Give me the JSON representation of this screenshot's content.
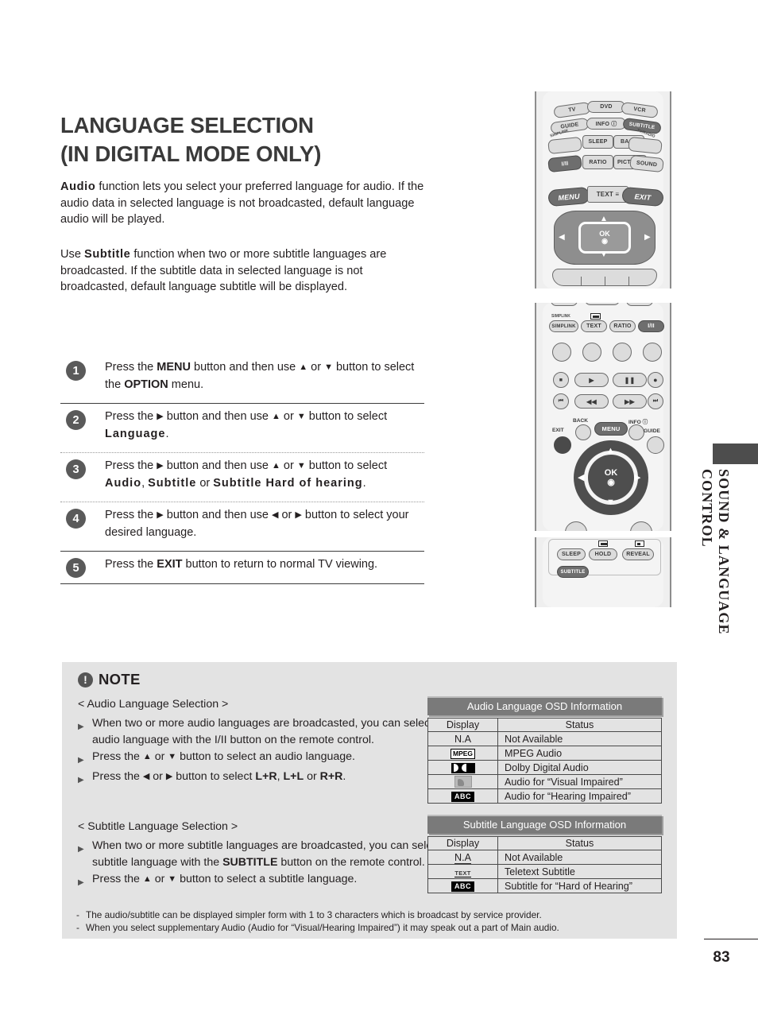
{
  "title": {
    "line1": "LANGUAGE SELECTION",
    "line2": "(IN DIGITAL MODE ONLY)"
  },
  "intro": {
    "p1_bold": "Audio",
    "p1_rest": " function lets you select your preferred language for audio. If the audio data in selected language is not broadcasted, default language audio will be played.",
    "p2_pre": "Use ",
    "p2_bold": "Subtitle",
    "p2_rest": " function when two or more subtitle languages are broadcasted. If the subtitle data in selected language is not broadcasted, default language subtitle will be displayed."
  },
  "steps": [
    {
      "num": "1",
      "html": "Press the <b>MENU</b> button and then use <span class=\"arw\">▲</span> or <span class=\"arw\">▼</span> button to select the <b>OPTION</b> menu."
    },
    {
      "num": "2",
      "html": "Press the <span class=\"arw\">▶</span> button and then use <span class=\"arw\">▲</span> or <span class=\"arw\">▼</span> button to select <span class=\"sp\">Language</span>."
    },
    {
      "num": "3",
      "html": "Press the <span class=\"arw\">▶</span> button and then use <span class=\"arw\">▲</span> or <span class=\"arw\">▼</span> button to select <span class=\"sp\">Audio</span>, <span class=\"sp\">Subtitle</span> or <span class=\"sp\">Subtitle Hard of hearing</span>."
    },
    {
      "num": "4",
      "html": "Press the <span class=\"arw\">▶</span> button and then use <span class=\"arw\">◀</span> or <span class=\"arw\">▶</span> button to select your desired language."
    },
    {
      "num": "5",
      "html": "Press the <b>EXIT</b> button to return to normal TV viewing."
    }
  ],
  "remote1": {
    "buttons": [
      "TV",
      "DVD",
      "VCR",
      "GUIDE",
      "INFO ⓘ",
      "SUBTITLE",
      "SIMPLINK",
      "SLEEP",
      "BACK",
      "TV/RADIO",
      "I/II",
      "RATIO",
      "PICTURE",
      "SOUND",
      "MENU",
      "TEXT ≡",
      "EXIT",
      "OK"
    ]
  },
  "remote2": {
    "buttons": [
      "SIMPLINK",
      "TEXT",
      "RATIO",
      "I/II",
      "BACK",
      "MENU",
      "INFO ⓘ",
      "EXIT",
      "GUIDE",
      "OK"
    ]
  },
  "remote3": {
    "buttons": [
      "SLEEP",
      "HOLD",
      "REVEAL",
      "SUBTITLE"
    ]
  },
  "side_tab": {
    "label": "SOUND & LANGUAGE CONTROL"
  },
  "note": {
    "badge": "!",
    "title": "NOTE",
    "audio_heading": "< Audio Language Selection >",
    "audio_items": [
      "When two or more audio languages are broadcasted, you can select audio language with the I/II button on the remote control.",
      "Press the <span class=\"arw\">▲</span> or <span class=\"arw\">▼</span> button to select an audio language.",
      "Press the <span class=\"arw\">◀</span> or <span class=\"arw\">▶</span> button to select <b>L+R</b>, <b>L+L</b> or <b>R+R</b>."
    ],
    "subtitle_heading": "< Subtitle Language Selection >",
    "subtitle_items": [
      "When two or more subtitle languages are broadcasted, you can select subtitle language with the <b>SUBTITLE</b> button on the remote control.",
      "Press the <span class=\"arw\">▲</span> or <span class=\"arw\">▼</span> button to select a subtitle language."
    ]
  },
  "osd_audio": {
    "title": "Audio Language OSD Information",
    "headers": [
      "Display",
      "Status"
    ],
    "rows": [
      {
        "display": "N.A",
        "display_kind": "text",
        "status": "Not Available"
      },
      {
        "display": "MPEG",
        "display_kind": "mpeg",
        "status": "MPEG Audio"
      },
      {
        "display": "DD",
        "display_kind": "dolby",
        "status": "Dolby Digital Audio"
      },
      {
        "display": "",
        "display_kind": "visual-impaired",
        "status": "Audio for “Visual Impaired”"
      },
      {
        "display": "ABC",
        "display_kind": "abc",
        "status": "Audio for “Hearing Impaired”"
      }
    ]
  },
  "osd_subtitle": {
    "title": "Subtitle Language OSD Information",
    "headers": [
      "Display",
      "Status"
    ],
    "rows": [
      {
        "display": "N.A",
        "display_kind": "text-underline",
        "status": "Not Available"
      },
      {
        "display": "TEXT",
        "display_kind": "teletext",
        "status": "Teletext Subtitle"
      },
      {
        "display": "ABC",
        "display_kind": "abc",
        "status": "Subtitle for “Hard of Hearing”"
      }
    ]
  },
  "footnotes": [
    "The audio/subtitle can be displayed simpler form with 1 to 3 characters which is broadcast by service provider.",
    "When you select supplementary Audio (Audio for “Visual/Hearing Impaired”) it may speak out a part of Main audio."
  ],
  "page_number": "83",
  "colors": {
    "note_bg": "#e3e3e3",
    "osd_title_bg": "#7a7a7a",
    "step_circle": "#5a5a5a",
    "remote_bg": "#efefef",
    "title_gray": "#3a3a3a"
  }
}
